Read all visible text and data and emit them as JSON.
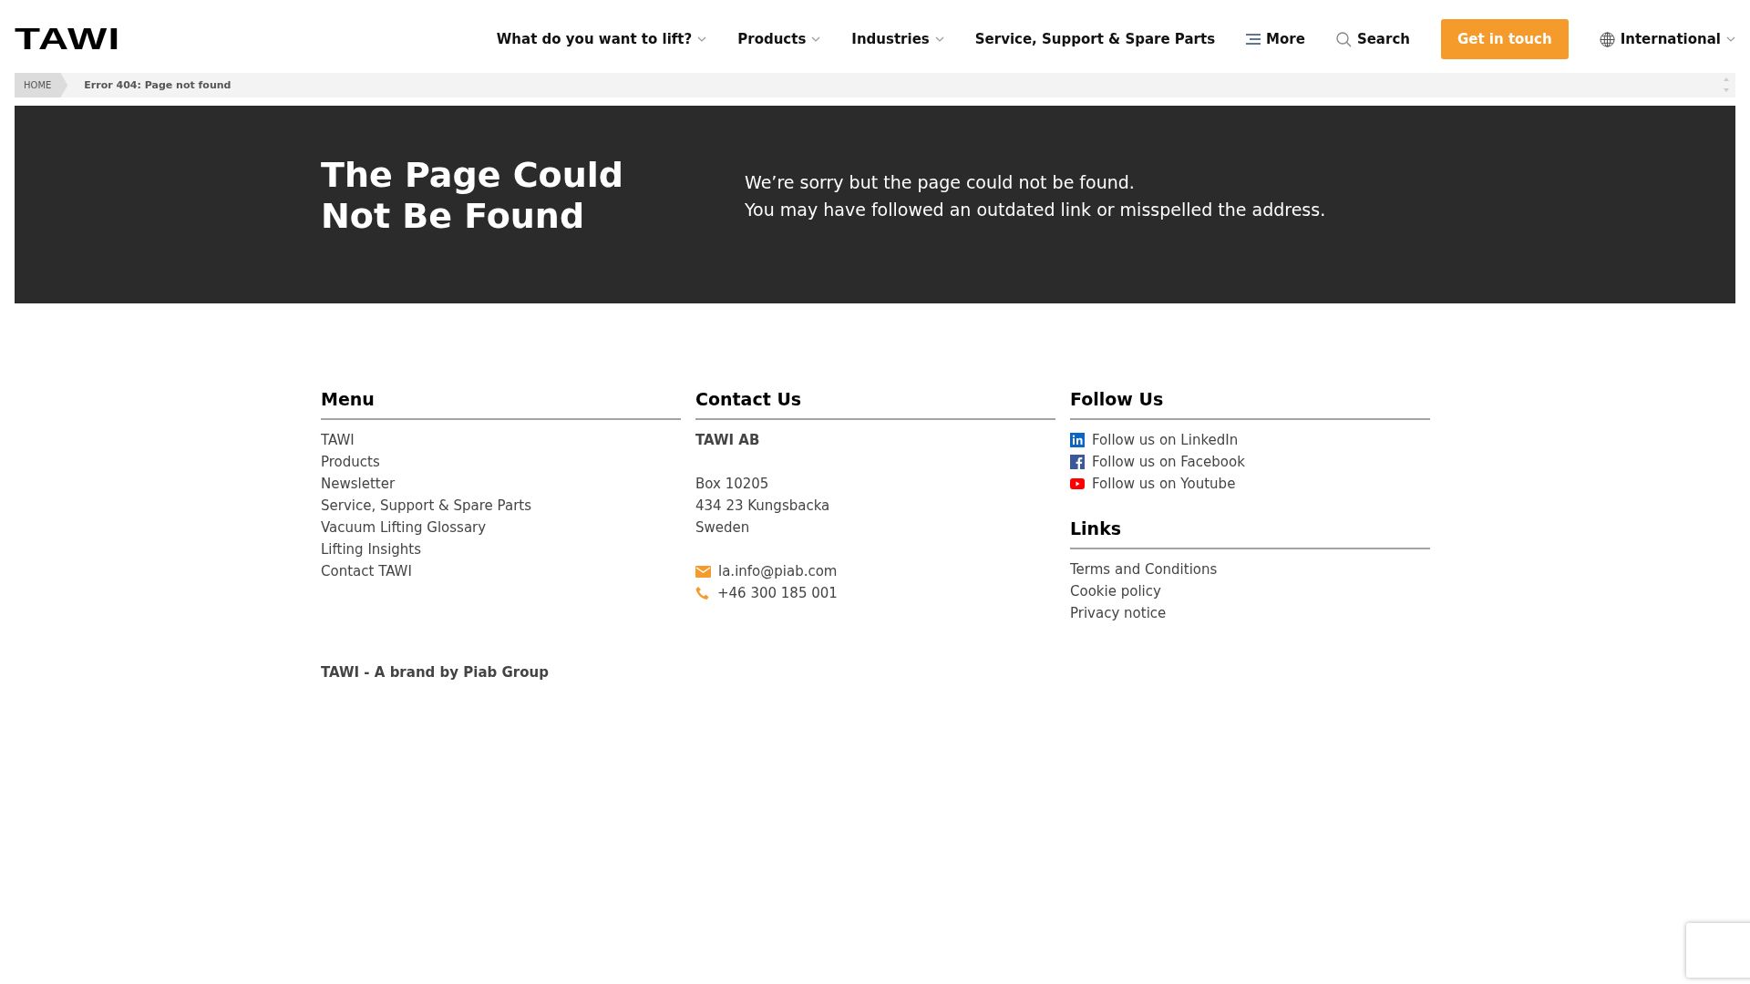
{
  "header": {
    "logo": "TAWI",
    "nav": [
      {
        "label": "What do you want to lift?",
        "kind": "dropdown"
      },
      {
        "label": "Products",
        "kind": "dropdown"
      },
      {
        "label": "Industries",
        "kind": "dropdown"
      },
      {
        "label": "Service, Support & Spare Parts",
        "kind": "link"
      },
      {
        "label": "More",
        "kind": "menu"
      },
      {
        "label": "Search",
        "kind": "search"
      },
      {
        "label": "Get in touch",
        "kind": "cta"
      },
      {
        "label": "International",
        "kind": "language"
      }
    ]
  },
  "breadcrumb": [
    {
      "label": "HOME",
      "selected": false
    },
    {
      "label": "Error 404: Page not found",
      "selected": true
    }
  ],
  "hero": {
    "title": "The Page Could Not Be Found",
    "lines": [
      "We’re sorry but the page could not be found.",
      "You may have followed an outdated link or misspelled the address."
    ]
  },
  "footer": {
    "menu": {
      "title": "Menu",
      "items": [
        "TAWI",
        "Products",
        "Newsletter",
        "Service, Support & Spare Parts",
        "Vacuum Lifting Glossary",
        "Lifting Insights",
        "Contact TAWI"
      ]
    },
    "contact": {
      "title": "Contact Us",
      "items": [
        {
          "text": "TAWI AB",
          "kind": "company"
        },
        {
          "text": "Box 10205",
          "kind": "address"
        },
        {
          "text": "434 23 Kungsbacka",
          "kind": "address"
        },
        {
          "text": "Sweden",
          "kind": "address"
        },
        {
          "text": "la.info@piab.com",
          "kind": "email"
        },
        {
          "text": "+46 300 185 001",
          "kind": "phone"
        }
      ]
    },
    "follow": {
      "title": "Follow Us",
      "items": [
        {
          "text": "Follow us on LinkedIn",
          "kind": "linkedin"
        },
        {
          "text": "Follow us on Facebook",
          "kind": "facebook"
        },
        {
          "text": "Follow us on Youtube",
          "kind": "youtube"
        }
      ]
    },
    "links": {
      "title": "Links",
      "items": [
        "Terms and Conditions",
        "Cookie policy",
        "Privacy notice"
      ]
    },
    "brand": "TAWI - A brand by Piab Group"
  }
}
